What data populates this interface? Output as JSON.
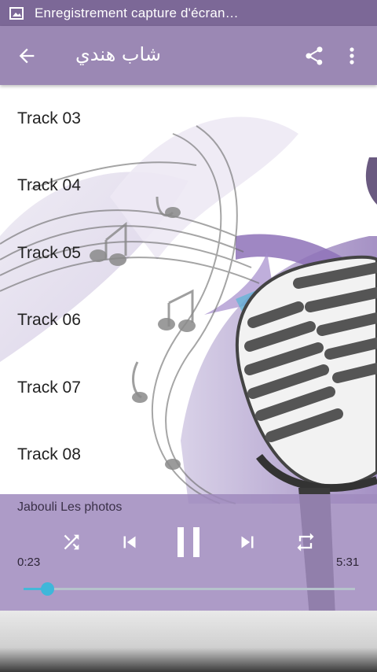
{
  "status_bar": {
    "text": "Enregistrement capture d'écran…",
    "icon": "screenshot-icon"
  },
  "app_bar": {
    "title": "شاب هندي",
    "back_icon": "arrow-left-icon",
    "share_icon": "share-icon",
    "more_icon": "more-vert-icon"
  },
  "tracks": [
    {
      "label": "Track 03"
    },
    {
      "label": "Track 04"
    },
    {
      "label": "Track 05"
    },
    {
      "label": "Track 06"
    },
    {
      "label": "Track 07"
    },
    {
      "label": "Track 08"
    }
  ],
  "player": {
    "song_title": "Jabouli Les photos",
    "elapsed": "0:23",
    "duration": "5:31",
    "progress": 0.07,
    "controls": [
      "shuffle-icon",
      "skip-previous-icon",
      "pause-icon",
      "skip-next-icon",
      "repeat-icon"
    ]
  },
  "colors": {
    "status_bar": "#7c6897",
    "app_bar": "#9b88b4",
    "player": "#a08abe",
    "seek": "#3eb7da"
  }
}
